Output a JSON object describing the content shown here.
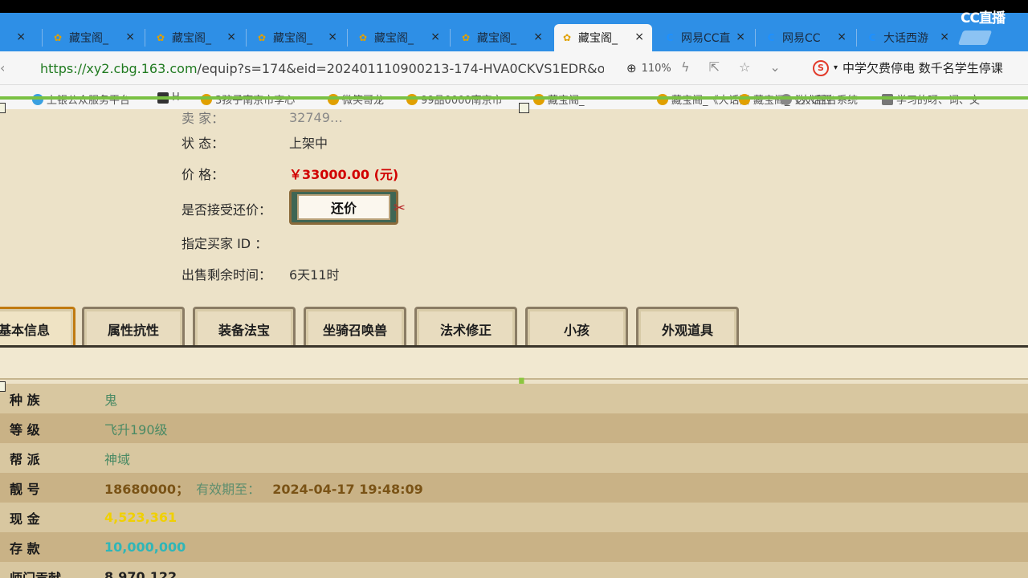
{
  "browser": {
    "tabs": [
      {
        "label": "",
        "icon": "cbg-chicken-icon",
        "active": false
      },
      {
        "label": "藏宝阁_",
        "icon": "cbg-chicken-icon",
        "active": false
      },
      {
        "label": "藏宝阁_",
        "icon": "cbg-chicken-icon",
        "active": false
      },
      {
        "label": "藏宝阁_",
        "icon": "cbg-chicken-icon",
        "active": false
      },
      {
        "label": "藏宝阁_",
        "icon": "cbg-chicken-icon",
        "active": false
      },
      {
        "label": "藏宝阁_",
        "icon": "cbg-chicken-icon",
        "active": false
      },
      {
        "label": "藏宝阁_",
        "icon": "cbg-chicken-icon",
        "active": true
      },
      {
        "label": "网易CC直",
        "icon": "cc-icon",
        "active": false
      },
      {
        "label": "网易CC",
        "icon": "cc-icon",
        "active": false
      },
      {
        "label": "大话西游",
        "icon": "cc-icon",
        "active": false
      }
    ],
    "close_glyph": "×",
    "watermark": "CC直播",
    "url_host": "https://xy2.cbg.163.com",
    "url_rest": "/equip?s=174&eid=202401110900213-174-HVA0CKVS1EDR&o&",
    "zoom": "110%",
    "news_headline": "中学欠费停电 数千名学生停课",
    "bookmarks": [
      "上银公众服务平台",
      "H",
      "3孩子南京市李心",
      "微笑哥龙",
      "99品0000南京市",
      "藏宝阁_",
      "藏宝阁_《大话西",
      "藏宝阁_《大话西",
      "达人后台系统",
      "学习的呀、词、文"
    ]
  },
  "item_info": {
    "rows": [
      {
        "label": "状      态：",
        "value": "上架中"
      },
      {
        "label": "价      格：",
        "value": "￥33000.00 (元)"
      },
      {
        "label": "是否接受还价：",
        "value": ""
      },
      {
        "label": "指定买家 ID ：",
        "value": ""
      },
      {
        "label": "出售剩余时间：",
        "value": "6天11时"
      }
    ],
    "counter_offer_button": "还价"
  },
  "game_tabs": [
    "基本信息",
    "属性抗性",
    "装备法宝",
    "坐骑召唤兽",
    "法术修正",
    "小孩",
    "外观道具"
  ],
  "attributes": [
    {
      "label": "种    族",
      "value": "鬼",
      "style": "green"
    },
    {
      "label": "等    级",
      "value": "飞升190级",
      "style": "green"
    },
    {
      "label": "帮    派",
      "value": "神域",
      "style": "green"
    },
    {
      "label": "靓    号",
      "value": "18680000；",
      "extra_label": "有效期至：",
      "extra_value": "2024-04-17 19:48:09",
      "style": "brown"
    },
    {
      "label": "现    金",
      "value": "4,523,361",
      "style": "yellow"
    },
    {
      "label": "存    款",
      "value": "10,000,000",
      "style": "cyan"
    },
    {
      "label": "师门贡献",
      "value": "8,970,122",
      "style": "dark"
    }
  ],
  "colors": {
    "price": "#d10000",
    "tab_bar": "#2e8fe6",
    "accent_green": "#7ac143",
    "page_bg": "#ece2c8"
  }
}
